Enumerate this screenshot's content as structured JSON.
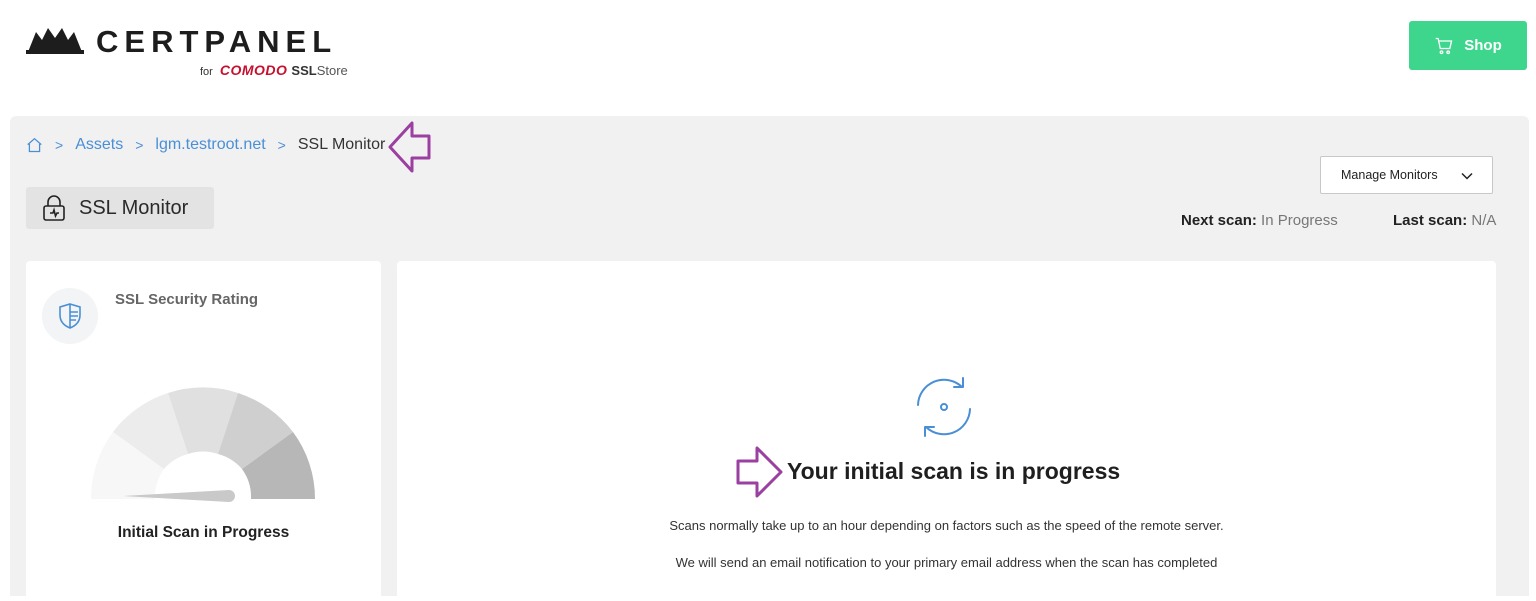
{
  "brand": {
    "name": "CERTPANEL",
    "sub_for": "for",
    "sub_comodo": "COMODO",
    "sub_ssl": "SSL",
    "sub_store": "Store",
    "comodo_color": "#c8102e"
  },
  "header": {
    "shop_label": "Shop",
    "shop_color": "#3dd68c"
  },
  "breadcrumb": {
    "home_icon": "home-icon",
    "items": [
      "Assets",
      "lgm.testroot.net",
      "SSL Monitor"
    ],
    "separator": ">"
  },
  "page": {
    "title": "SSL Monitor",
    "title_icon": "lock-icon"
  },
  "toolbar": {
    "manage_monitors_label": "Manage Monitors"
  },
  "scan_status": {
    "next_label": "Next scan:",
    "next_value": "In Progress",
    "last_label": "Last scan:",
    "last_value": "N/A"
  },
  "rating_card": {
    "title": "SSL Security Rating",
    "status": "Initial Scan in Progress",
    "icon": "shield-icon"
  },
  "progress_card": {
    "heading": "Your initial scan is in progress",
    "line1": "Scans normally take up to an hour depending on factors such as the speed of the remote server.",
    "line2": "We will send an email notification to your primary email address when the scan has completed",
    "icon": "refresh-icon"
  },
  "annotation": {
    "arrow_color": "#9b3fa1"
  }
}
